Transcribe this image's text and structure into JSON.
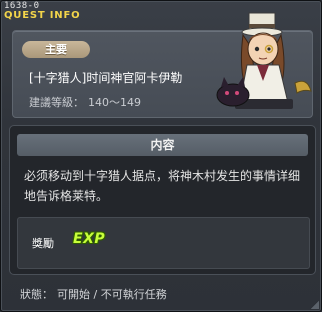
{
  "window": {
    "quest_id": "1638-0",
    "title": "QUEST INFO"
  },
  "quest": {
    "type_badge": "主要",
    "name": "[十字猎人]时间神官阿卡伊勒",
    "level_label": "建議等級：",
    "level_range": "140～149"
  },
  "content": {
    "header": "内容",
    "description": "必须移动到十字猎人据点，将神木村发生的事情详细地告诉格莱特。",
    "reward_label": "獎勵",
    "reward_icon_text": "EXP"
  },
  "status": {
    "label": "狀態：",
    "value": "可開始 / 不可執行任務"
  },
  "colors": {
    "title": "#f3d54a",
    "badge": "#b8a688",
    "exp": "#c8ff3a"
  },
  "icons": [
    "npc-portrait-icon",
    "exp-icon"
  ]
}
